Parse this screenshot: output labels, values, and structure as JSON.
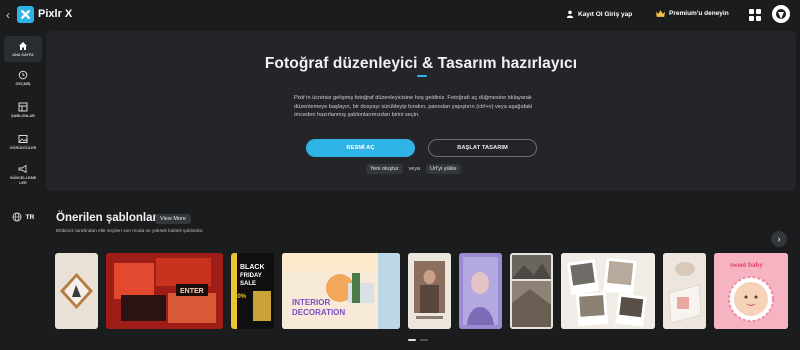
{
  "header": {
    "back_icon": "chevron-left-icon",
    "app_name": "Pixlr X",
    "login_label": "Kayıt Ol Giriş yap",
    "premium_label": "Premium'u deneyin"
  },
  "sidebar": {
    "items": [
      {
        "label": "ANA SAYFA",
        "icon": "home-icon"
      },
      {
        "label": "GEÇMİŞ",
        "icon": "history-icon"
      },
      {
        "label": "ŞABLONLAR",
        "icon": "templates-icon"
      },
      {
        "label": "GÖRÜNTÜLER",
        "icon": "image-icon"
      },
      {
        "label": "GÜNCELLEME LER",
        "icon": "megaphone-icon"
      }
    ],
    "language": "TR"
  },
  "hero": {
    "title": "Fotoğraf düzenleyici & Tasarım hazırlayıcı",
    "description": "Pixlr'ın ücretsiz gelişmiş fotoğraf düzenleyicisine hoş geldiniz. Fotoğrafı aç düğmesine tıklayarak düzenlemeye başlayın, bir dosyayı sürükleyip bırakın, panodan yapıştırın (ctrl+v) veya aşağıdaki önceden hazırlanmış şablonlarımızdan birini seçin.",
    "open_button": "RESMİ AÇ",
    "design_button": "BAŞLAT TASARIM",
    "create_new": "Yeni oluştur",
    "or": "veya",
    "load_url": "Url'yi yükle"
  },
  "templates": {
    "title": "Önerilen şablonlar",
    "view_more": "View More",
    "subtitle": "Ekibimiz tarafından elle seçilen son moda ve yüksek kaliteli şablonlar.",
    "thumb_texts": {
      "enter": "ENTER",
      "black": "BLACK",
      "friday": "FRIDAY",
      "sale": "SALE",
      "discount": "30%",
      "interior1": "INTERIOR",
      "interior2": "DECORATION",
      "sweet": "sweet baby"
    }
  },
  "colors": {
    "accent": "#2fb3e5",
    "background": "#1a1c1e",
    "panel": "#232528"
  }
}
